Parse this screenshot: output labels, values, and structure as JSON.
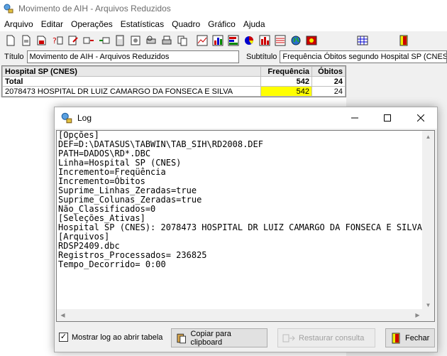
{
  "app": {
    "title": "Movimento de AIH - Arquivos Reduzidos"
  },
  "menu": [
    "Arquivo",
    "Editar",
    "Operações",
    "Estatísticas",
    "Quadro",
    "Gráfico",
    "Ajuda"
  ],
  "toolbar_icons": [
    "new-icon",
    "open-icon",
    "save-icon",
    "query-icon",
    "edit-icon",
    "table-import-icon",
    "table-export-icon",
    "calculator-icon",
    "settings-icon",
    "print-preview-icon",
    "print-icon",
    "copy-icon",
    "chart-line-icon",
    "chart-bar-icon",
    "chart-hbar-icon",
    "chart-pie-icon",
    "chart-scatter-icon",
    "chart-histogram-icon",
    "map-icon",
    "color-icon",
    "grid-icon",
    "exit-icon"
  ],
  "fields": {
    "title_label": "Título",
    "title_value": "Movimento de AIH - Arquivos Reduzidos",
    "subtitle_label": "Subtítulo",
    "subtitle_value": "Frequência Óbitos segundo Hospital SP (CNES)"
  },
  "table": {
    "headers": [
      "Hospital SP (CNES)",
      "Frequência",
      "Óbitos"
    ],
    "total": {
      "label": "Total",
      "freq": "542",
      "obitos": "24"
    },
    "rows": [
      {
        "label": "2078473 HOSPITAL DR LUIZ CAMARGO DA FONSECA E SILVA",
        "freq": "542",
        "obitos": "24"
      }
    ]
  },
  "log": {
    "title": "Log",
    "text": "[Opções]\nDEF=D:\\DATASUS\\TABWIN\\TAB_SIH\\RD2008.DEF\nPATH=DADOS\\RD*.DBC\nLinha=Hospital SP (CNES)\nIncremento=Freqüência\nIncremento=Óbitos\nSuprime_Linhas_Zeradas=true\nSuprime_Colunas_Zeradas=true\nNão_Classificados=0\n[Seleções_Ativas]\nHospital SP (CNES): 2078473 HOSPITAL DR LUIZ CAMARGO DA FONSECA E SILVA\n[Arquivos]\nRDSP2409.dbc\nRegistros_Processados= 236825\nTempo_Decorrido= 0:00",
    "show_log_label": "Mostrar log ao abrir tabela",
    "show_log_checked": true,
    "copy_label": "Copiar para clipboard",
    "restore_label": "Restaurar consulta",
    "close_label": "Fechar"
  },
  "colors": {
    "highlight": "#ffff00",
    "accent": "#0078d7"
  }
}
